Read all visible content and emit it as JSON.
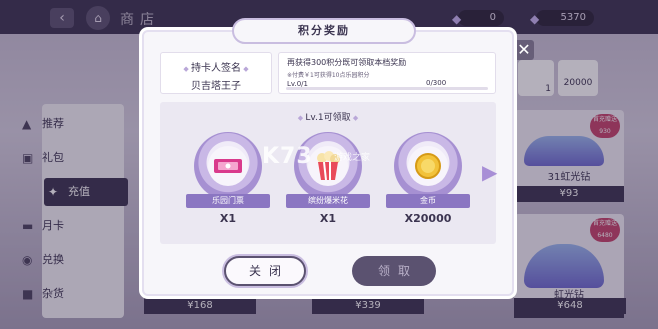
{
  "header": {
    "title": "商店",
    "back_icon": "back-arrow-icon",
    "home_icon": "home-icon",
    "currency1_value": "0",
    "currency2_value": "5370"
  },
  "sidebar": {
    "items": [
      {
        "label": "推荐",
        "icon": "thumbs-up-icon"
      },
      {
        "label": "礼包",
        "icon": "gift-icon"
      },
      {
        "label": "充值",
        "icon": "recharge-icon",
        "active": true
      },
      {
        "label": "月卡",
        "icon": "card-icon"
      },
      {
        "label": "兑换",
        "icon": "exchange-icon"
      },
      {
        "label": "杂货",
        "icon": "bag-icon"
      }
    ]
  },
  "shop_cards": [
    {
      "tag": "首充赠送",
      "tag_value": "930",
      "name": "31虹光钻",
      "price": "¥93"
    },
    {
      "tag": "首充赠送",
      "tag_value": "6480",
      "name": "虹光钻",
      "price": "¥648"
    }
  ],
  "top_items": [
    {
      "count": "1"
    },
    {
      "count": "20000"
    }
  ],
  "bottom_prices": [
    "¥168",
    "¥339",
    "¥648"
  ],
  "modal": {
    "title": "积分奖励",
    "holder_label": "持卡人签名",
    "holder_name": "贝吉塔王子",
    "info_main": "再获得300积分既可领取本档奖励",
    "info_sub": "※付费￥1可获得10点乐园积分",
    "level": "Lv.0/1",
    "progress_text": "0/300",
    "progress_fraction": 0.0,
    "reward_header": "Lv.1可领取",
    "rewards": [
      {
        "name": "乐园门票",
        "count": "X1",
        "icon": "ticket-icon"
      },
      {
        "name": "缤纷爆米花",
        "count": "X1",
        "icon": "popcorn-icon"
      },
      {
        "name": "金币",
        "count": "X20000",
        "icon": "gold-coin-icon"
      }
    ],
    "close_label": "关闭",
    "claim_label": "领取"
  },
  "watermark": {
    "main": "K73",
    "sub": "游戏之家"
  },
  "colors": {
    "accent": "#8b76c2",
    "dark": "#3b3450",
    "background": "#f7f6fa"
  }
}
